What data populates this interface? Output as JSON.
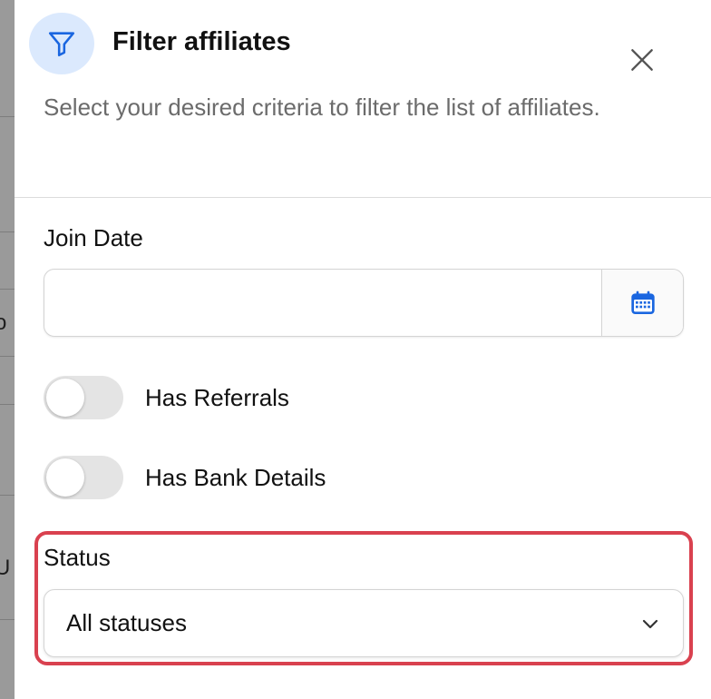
{
  "dialog": {
    "title": "Filter affiliates",
    "subtitle": "Select your desired criteria to filter the list of affiliates.",
    "icon": "filter-funnel-icon",
    "close_icon": "close-icon",
    "accent_color": "#1a66e0",
    "icon_bg_color": "#dbe9fd"
  },
  "fields": {
    "join_date": {
      "label": "Join Date",
      "value": "",
      "icon": "calendar-icon"
    },
    "has_referrals": {
      "label": "Has Referrals",
      "checked": false
    },
    "has_bank_details": {
      "label": "Has Bank Details",
      "checked": false
    },
    "status": {
      "label": "Status",
      "selected": "All statuses",
      "icon": "chevron-down-icon",
      "highlight_color": "#d9414f"
    }
  },
  "backdrop": {
    "fragments": [
      "o",
      "U"
    ]
  }
}
